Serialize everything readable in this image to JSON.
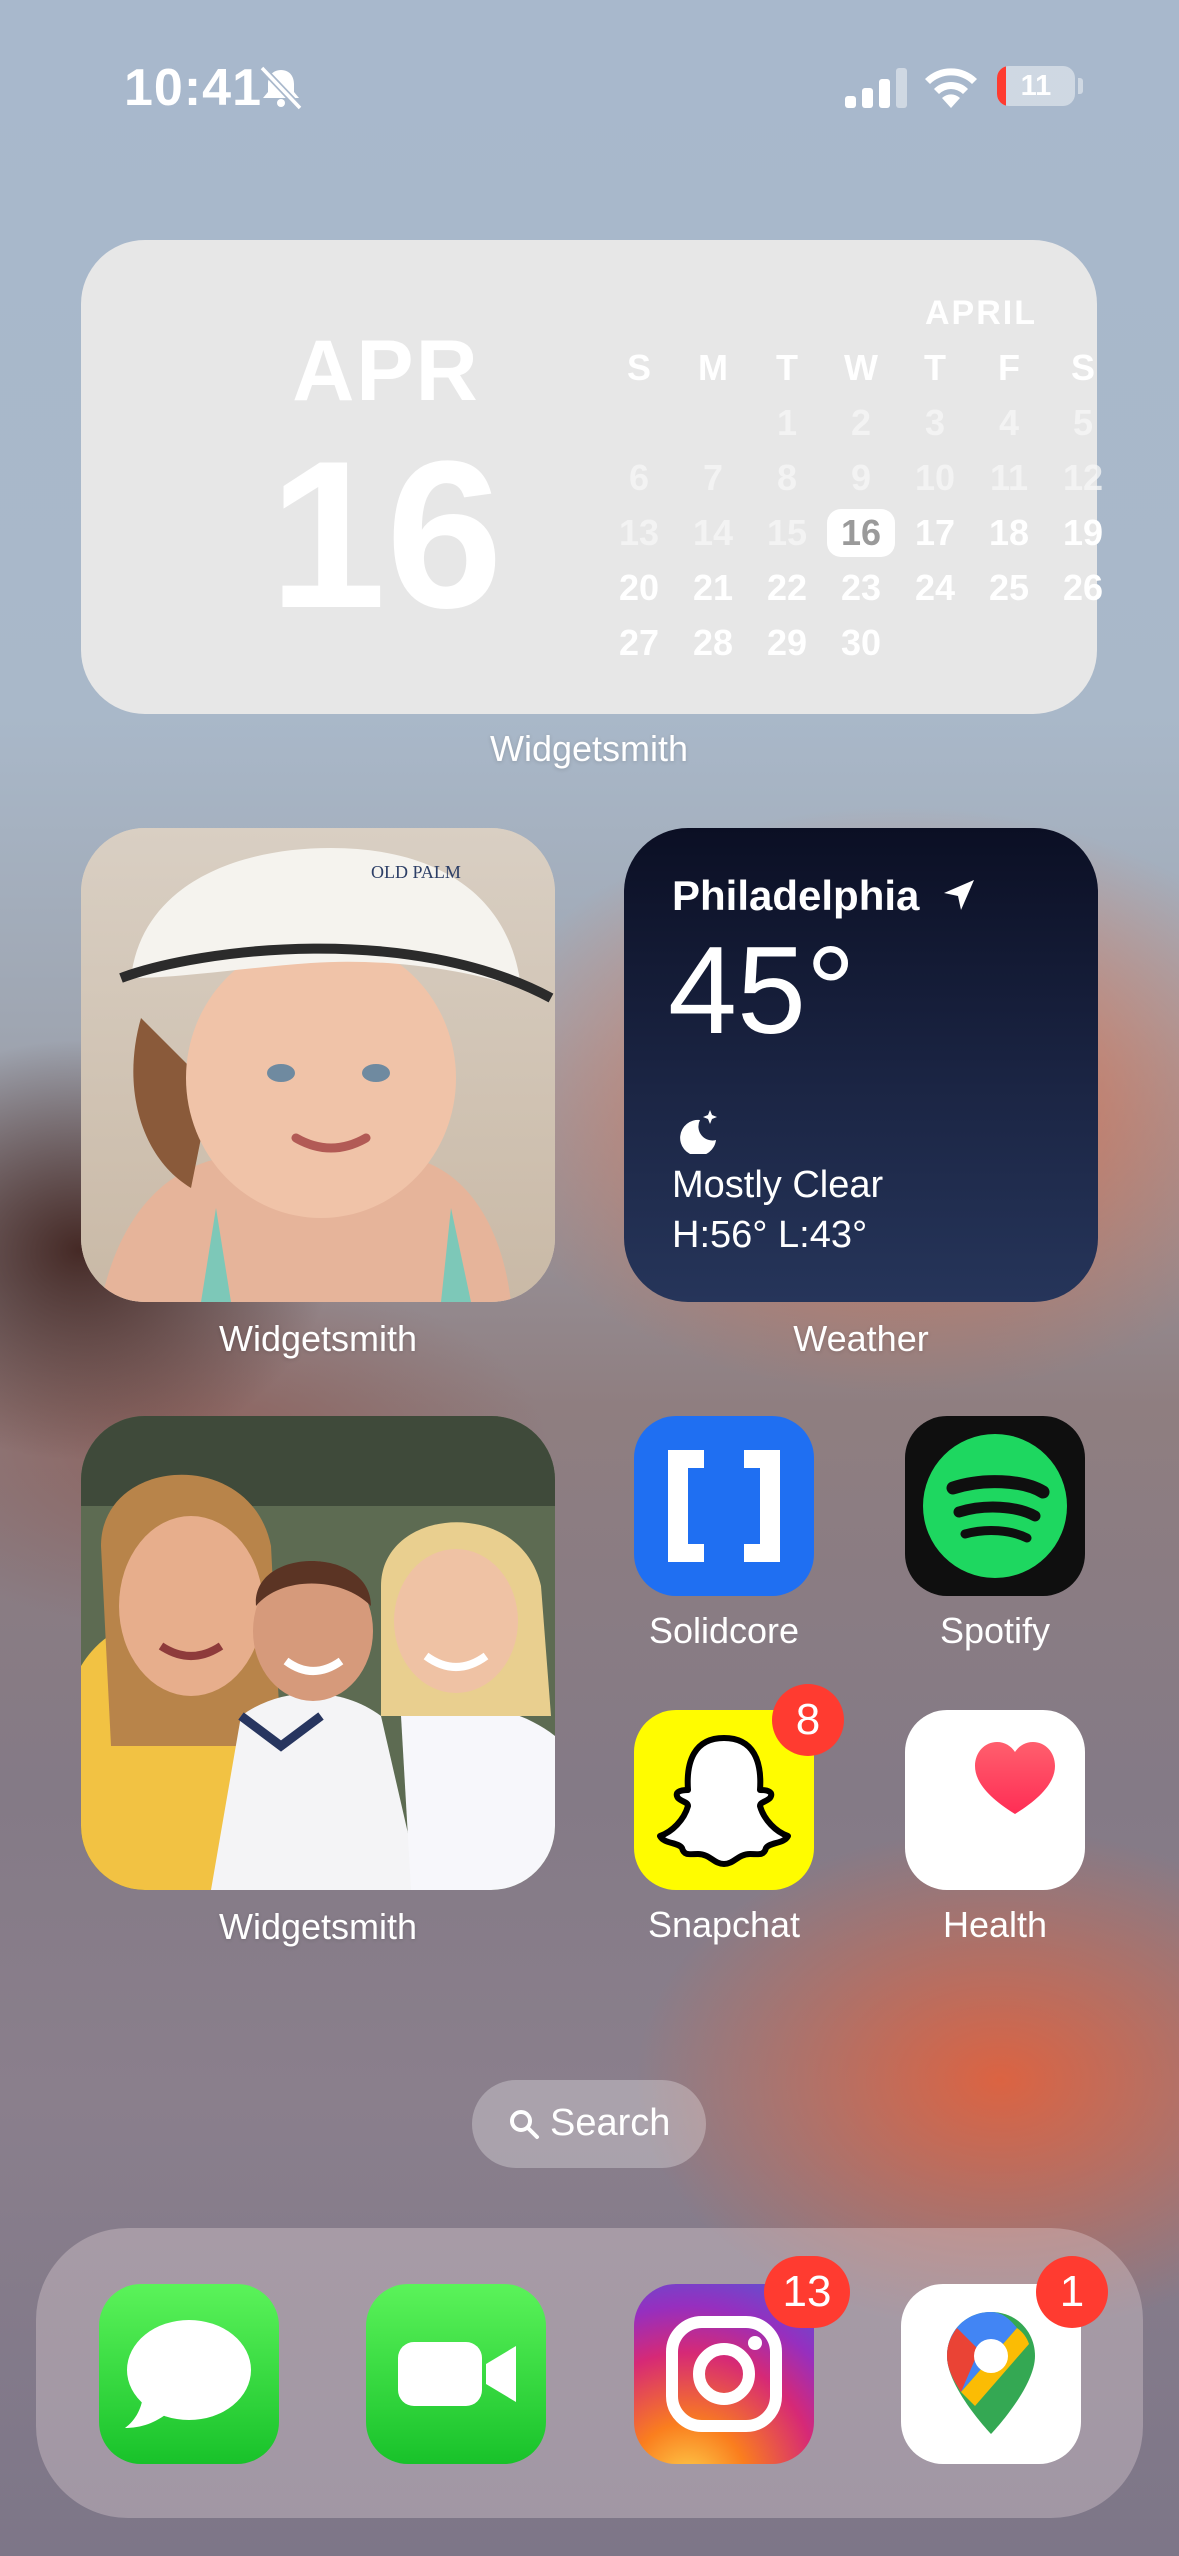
{
  "status_bar": {
    "time": "10:41",
    "battery_percent": "11",
    "battery_level": 0.11,
    "icons": [
      "bell-slash-icon",
      "cellular-signal-icon",
      "wifi-icon",
      "battery-icon"
    ]
  },
  "calendar_widget": {
    "month_abbrev": "APR",
    "day": "16",
    "month_full": "APRIL",
    "weekday_headers": [
      "S",
      "M",
      "T",
      "W",
      "T",
      "F",
      "S"
    ],
    "weeks": [
      [
        "",
        "",
        "1",
        "2",
        "3",
        "4",
        "5"
      ],
      [
        "6",
        "7",
        "8",
        "9",
        "10",
        "11",
        "12"
      ],
      [
        "13",
        "14",
        "15",
        "16",
        "17",
        "18",
        "19"
      ],
      [
        "20",
        "21",
        "22",
        "23",
        "24",
        "25",
        "26"
      ],
      [
        "27",
        "28",
        "29",
        "30",
        "",
        "",
        ""
      ]
    ],
    "today": "16",
    "label": "Widgetsmith"
  },
  "photo_widget_1": {
    "label": "Widgetsmith"
  },
  "weather_widget": {
    "city": "Philadelphia",
    "temperature": "45°",
    "condition": "Mostly Clear",
    "high_low": "H:56° L:43°",
    "label": "Weather"
  },
  "photo_widget_2": {
    "label": "Widgetsmith"
  },
  "apps": {
    "solidcore": {
      "label": "Solidcore"
    },
    "spotify": {
      "label": "Spotify"
    },
    "snapchat": {
      "label": "Snapchat",
      "badge": "8"
    },
    "health": {
      "label": "Health"
    }
  },
  "search": {
    "label": "Search"
  },
  "dock": {
    "messages": {
      "name": "Messages"
    },
    "facetime": {
      "name": "FaceTime"
    },
    "instagram": {
      "name": "Instagram",
      "badge": "13"
    },
    "maps": {
      "name": "Google Maps",
      "badge": "1"
    }
  },
  "colors": {
    "badge_red": "#ff3b30",
    "spotify_green": "#1ed760",
    "solidcore_blue": "#1f6ff2",
    "snapchat_yellow": "#fffc00"
  }
}
